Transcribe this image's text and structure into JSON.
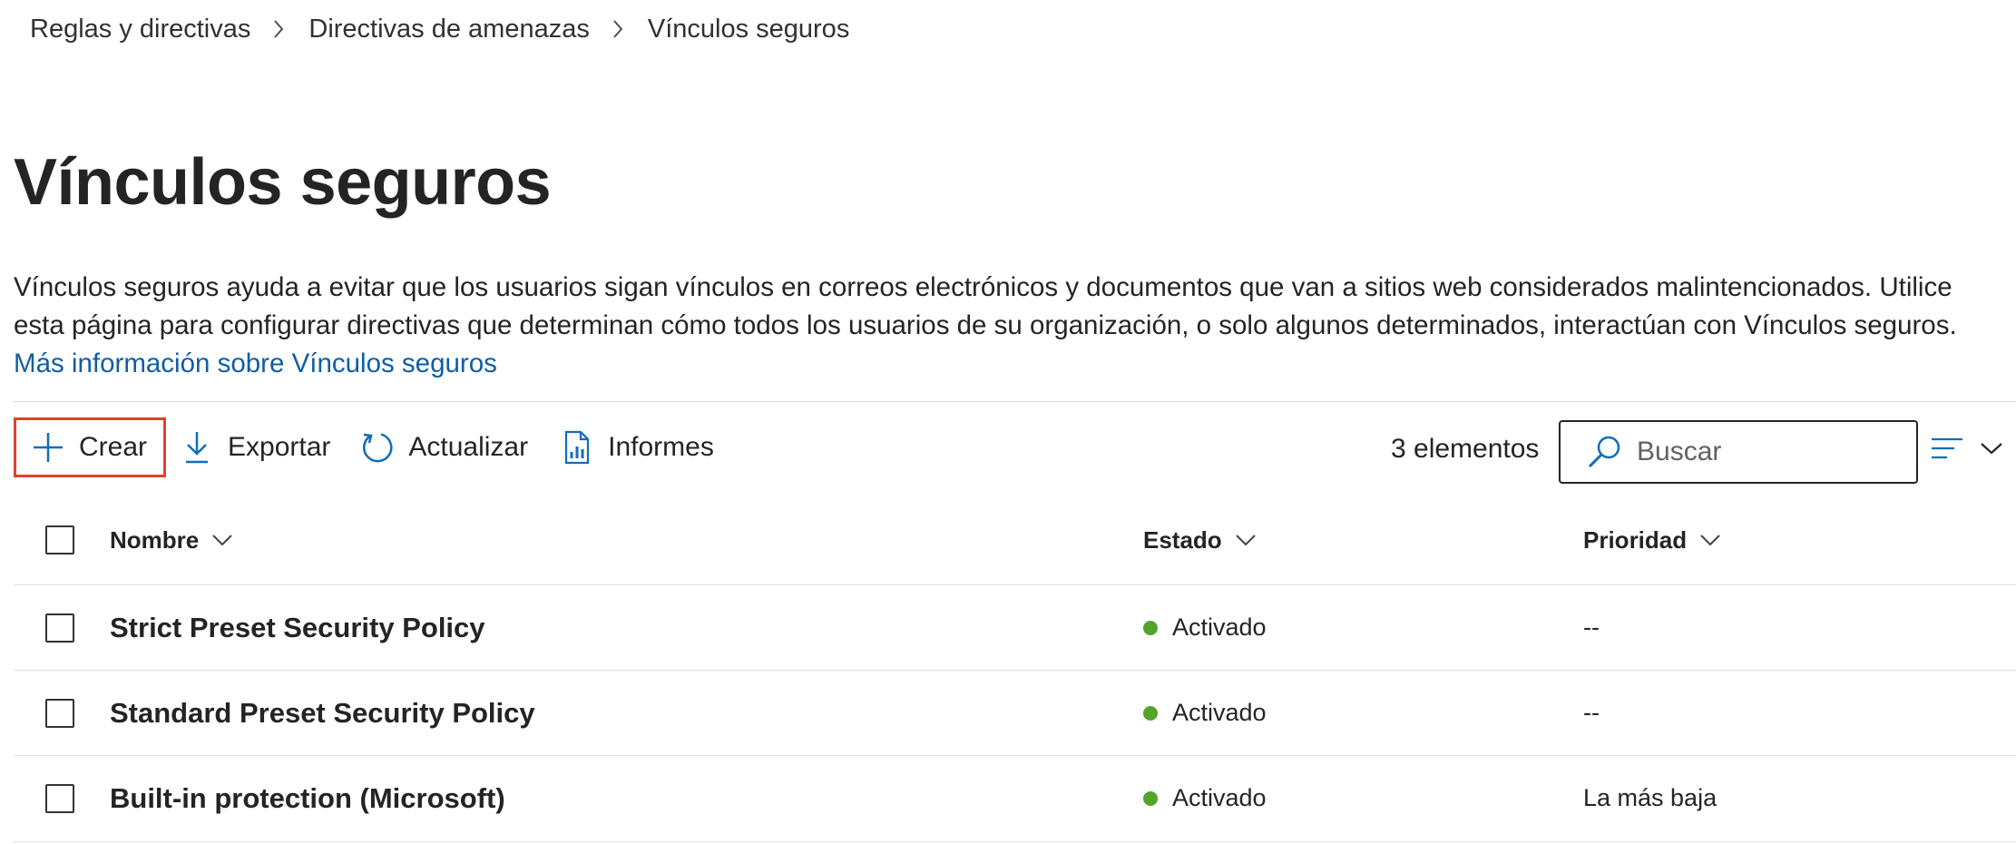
{
  "breadcrumb": [
    "Reglas y directivas",
    "Directivas de amenazas",
    "Vínculos seguros"
  ],
  "page": {
    "title": "Vínculos seguros",
    "description": "Vínculos seguros ayuda a evitar que los usuarios sigan vínculos en correos electrónicos y documentos que van a sitios web considerados malintencionados. Utilice esta página para configurar directivas que determinan cómo todos los usuarios de su organización, o solo algunos determinados, interactúan con Vínculos seguros.",
    "learn_more": "Más información sobre Vínculos seguros"
  },
  "toolbar": {
    "create": "Crear",
    "export": "Exportar",
    "refresh": "Actualizar",
    "reports": "Informes",
    "count": "3 elementos",
    "search_placeholder": "Buscar"
  },
  "table": {
    "columns": {
      "name": "Nombre",
      "state": "Estado",
      "priority": "Prioridad"
    },
    "rows": [
      {
        "name": "Strict Preset Security Policy",
        "state": "Activado",
        "priority": "--"
      },
      {
        "name": "Standard Preset Security Policy",
        "state": "Activado",
        "priority": "--"
      },
      {
        "name": "Built-in protection (Microsoft)",
        "state": "Activado",
        "priority": "La más baja"
      }
    ]
  },
  "colors": {
    "accent": "#0f5ea6",
    "highlight_border": "#e0412f",
    "status_on": "#54a32b"
  },
  "icons": [
    "chevron-right-icon",
    "plus-icon",
    "download-icon",
    "refresh-icon",
    "report-icon",
    "search-icon",
    "list-view-icon",
    "chevron-down-icon"
  ]
}
